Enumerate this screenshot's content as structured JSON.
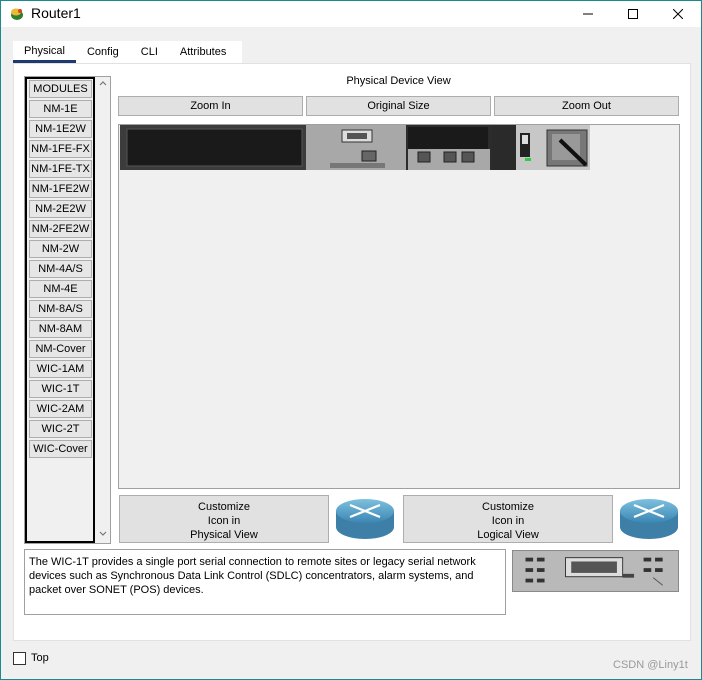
{
  "window": {
    "title": "Router1"
  },
  "tabs": [
    {
      "label": "Physical",
      "active": true
    },
    {
      "label": "Config",
      "active": false
    },
    {
      "label": "CLI",
      "active": false
    },
    {
      "label": "Attributes",
      "active": false
    }
  ],
  "modules": {
    "items": [
      "MODULES",
      "NM-1E",
      "NM-1E2W",
      "NM-1FE-FX",
      "NM-1FE-TX",
      "NM-1FE2W",
      "NM-2E2W",
      "NM-2FE2W",
      "NM-2W",
      "NM-4A/S",
      "NM-4E",
      "NM-8A/S",
      "NM-8AM",
      "NM-Cover",
      "WIC-1AM",
      "WIC-1T",
      "WIC-2AM",
      "WIC-2T",
      "WIC-Cover"
    ]
  },
  "physical_view": {
    "title": "Physical Device View",
    "zoom_in": "Zoom In",
    "original_size": "Original Size",
    "zoom_out": "Zoom Out"
  },
  "customize": {
    "physical": [
      "Customize",
      "Icon in",
      "Physical View"
    ],
    "logical": [
      "Customize",
      "Icon in",
      "Logical View"
    ]
  },
  "description": "The WIC-1T provides a single port serial connection to remote sites or legacy serial network devices such as Synchronous Data Link Control (SDLC) concentrators, alarm systems, and packet over SONET (POS) devices.",
  "footer": {
    "top_label": "Top",
    "watermark": "CSDN @Liny1t"
  },
  "icons": {
    "title": "packet-tracer-icon",
    "router": "router-icon",
    "wic": "wic-1t-module-icon"
  },
  "colors": {
    "border": "#1b8a8c",
    "tab_underline": "#1e3a6e",
    "router_blue": "#5aa0c8"
  }
}
